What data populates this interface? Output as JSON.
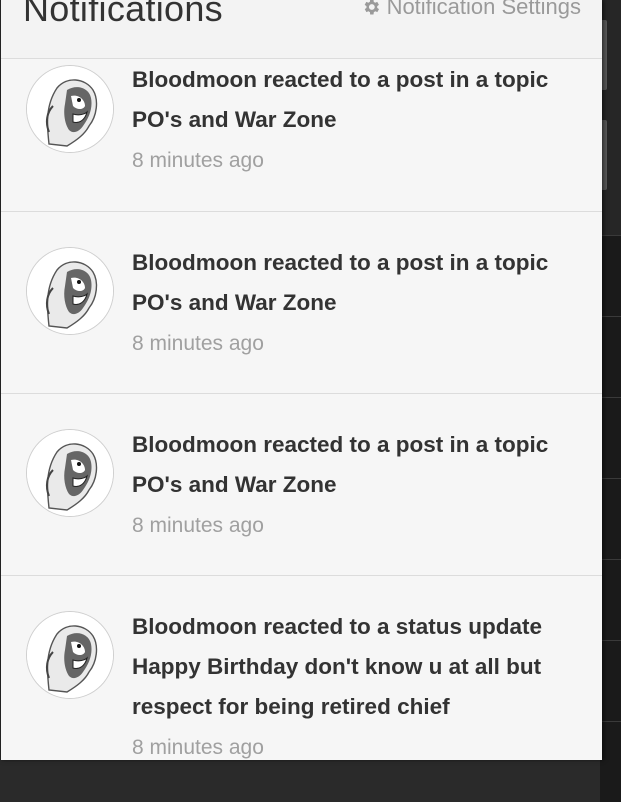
{
  "header": {
    "title": "Notifications",
    "settings_label": "Notification Settings",
    "settings_icon": "gear-icon"
  },
  "notifications": [
    {
      "actor": "Bloodmoon",
      "line1": "Bloodmoon reacted to a post in a topic",
      "line2": "PO's and War Zone",
      "time": "8 minutes ago"
    },
    {
      "actor": "Bloodmoon",
      "line1": "Bloodmoon reacted to a post in a topic",
      "line2": "PO's and War Zone",
      "time": "8 minutes ago"
    },
    {
      "actor": "Bloodmoon",
      "line1": "Bloodmoon reacted to a post in a topic",
      "line2": "PO's and War Zone",
      "time": "8 minutes ago"
    },
    {
      "actor": "Bloodmoon",
      "line1": "Bloodmoon reacted to a status update",
      "line2": "Happy Birthday don't know u at all but",
      "line3": "respect for being retired chief",
      "time": "8 minutes ago"
    }
  ],
  "colors": {
    "panel_bg": "#f6f6f6",
    "title": "#333333",
    "muted": "#a0a0a0",
    "backdrop": "#2a2a2a"
  }
}
